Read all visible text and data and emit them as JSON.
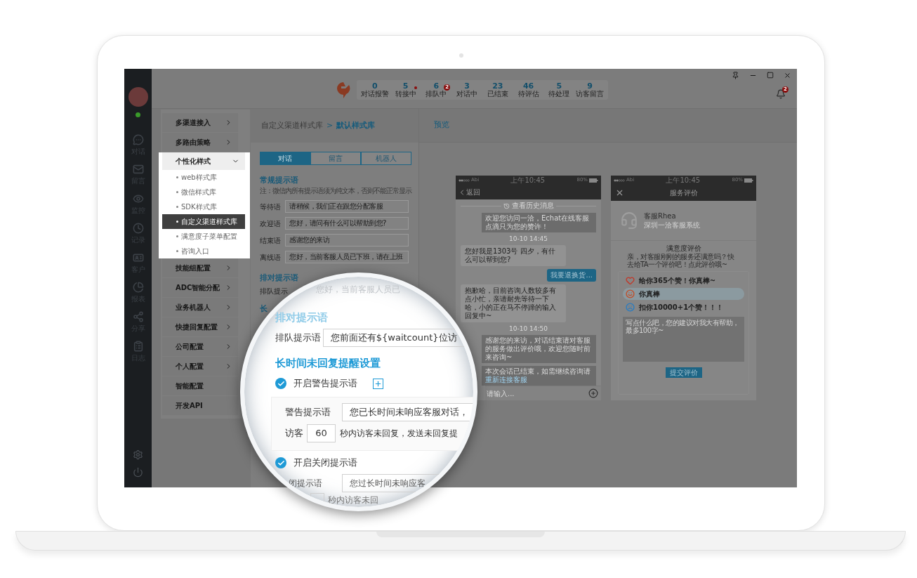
{
  "user": {
    "online": true
  },
  "rail": {
    "items": [
      {
        "kind": "chat",
        "label": "对话"
      },
      {
        "kind": "mail",
        "label": "留言"
      },
      {
        "kind": "eye",
        "label": "监控"
      },
      {
        "kind": "clock",
        "label": "记录"
      },
      {
        "kind": "card",
        "label": "客户"
      },
      {
        "kind": "pie",
        "label": "报表"
      },
      {
        "kind": "share",
        "label": "分享"
      },
      {
        "kind": "log",
        "label": "日志"
      }
    ]
  },
  "top_bar": {
    "stats": [
      {
        "value": "0",
        "label": "对话报警",
        "kind": "plain"
      },
      {
        "value": "5",
        "label": "转接中",
        "kind": "dot"
      },
      {
        "value": "6",
        "label": "排队中",
        "kind": "count",
        "badge": "2"
      },
      {
        "value": "3",
        "label": "对话中",
        "kind": "plain"
      },
      {
        "value": "23",
        "label": "已结束",
        "kind": "plain"
      },
      {
        "value": "46",
        "label": "待评估",
        "kind": "plain"
      },
      {
        "value": "5",
        "label": "待处理",
        "kind": "plain"
      },
      {
        "value": "9",
        "label": "访客留言",
        "kind": "plain"
      }
    ],
    "notifications": {
      "badge": "2"
    }
  },
  "settings_menu": {
    "items": [
      {
        "label": "多渠道接入",
        "expandable": true,
        "expanded": false
      },
      {
        "label": "多路由策略",
        "expandable": true,
        "expanded": false
      },
      {
        "label": "个性化样式",
        "expandable": true,
        "expanded": true,
        "children": [
          {
            "label": "web样式库",
            "selected": false
          },
          {
            "label": "微信样式库",
            "selected": false
          },
          {
            "label": "SDK样式库",
            "selected": false
          },
          {
            "label": "自定义渠道样式库",
            "selected": true
          },
          {
            "label": "满意度子菜单配置",
            "selected": false
          },
          {
            "label": "咨询入口",
            "selected": false
          }
        ]
      },
      {
        "label": "技能组配置",
        "expandable": true,
        "expanded": false
      },
      {
        "label": "ADC智能分配",
        "expandable": true,
        "expanded": false
      },
      {
        "label": "业务机器人",
        "expandable": true,
        "expanded": false
      },
      {
        "label": "快捷回复配置",
        "expandable": true,
        "expanded": false
      },
      {
        "label": "公司配置",
        "expandable": true,
        "expanded": false
      },
      {
        "label": "个人配置",
        "expandable": true,
        "expanded": false
      },
      {
        "label": "智能配置",
        "expandable": false,
        "expanded": false
      },
      {
        "label": "开发API",
        "expandable": false,
        "expanded": false
      }
    ]
  },
  "breadcrumb": {
    "parent": "自定义渠道样式库",
    "separator": ">",
    "current": "默认样式库"
  },
  "tabs": [
    {
      "label": "对话",
      "selected": true
    },
    {
      "label": "留言",
      "selected": false
    },
    {
      "label": "机器人",
      "selected": false
    }
  ],
  "general_prompts": {
    "heading": "常规提示语",
    "note": "注：微信内所有提示语须为纯文本，否则不能正常显示",
    "rows": [
      {
        "label": "等待语",
        "value": "请稍候，我们正在跟您分配客服"
      },
      {
        "label": "欢迎语",
        "value": "您好，请问有什么可以帮助到您?"
      },
      {
        "label": "结束语",
        "value": "感谢您的来访"
      },
      {
        "label": "离线语",
        "value": "您好，当前客服人员已下班，请在上班"
      }
    ]
  },
  "queue_prompt": {
    "heading": "排对提示语",
    "label": "排队提示"
  },
  "timeout_heading": "长",
  "preview": {
    "title": "预览",
    "chat_phone": {
      "status": {
        "carrier": "Abi",
        "time": "上午10:45",
        "battery": "80%"
      },
      "back": "返回",
      "messages": [
        {
          "kind": "history",
          "text": "查看历史消息"
        },
        {
          "kind": "system",
          "text": "欢迎您访问一洽，Echat在线客服点滴只为您的赞许！"
        },
        {
          "kind": "time",
          "text": "10-10 14:45"
        },
        {
          "kind": "agent",
          "text": "您好我是1303号 四夕，有什么可以帮到您?"
        },
        {
          "kind": "visitor",
          "text": "我要退换货..."
        },
        {
          "kind": "agent",
          "text": "抱歉哈，目前咨询人数较多有点小忙，亲请耐先等待一下哈，小的正在马不停蹄的输入回复中~"
        },
        {
          "kind": "time",
          "text": "10-10 14:50"
        },
        {
          "kind": "system",
          "text": "感谢您的来访，对话结束请对客服的服务做出评价哦，欢迎您随时前来咨询~"
        },
        {
          "kind": "ended",
          "text": "本次会话已结束，如需继续咨询请",
          "link": "重新连接客服"
        }
      ],
      "input_placeholder": "请输入..."
    },
    "rating_phone": {
      "status": {
        "carrier": "Abi",
        "time": "上午10:45",
        "battery": "80%"
      },
      "title": "服务评价",
      "agent": {
        "name": "客服Rhea",
        "company": "深圳一洽客服系统"
      },
      "heading": "满意度评价",
      "prompt": "亲，对客服刚刚的服务还满意吗？快去给TA一个评价吧！点此评价哦~",
      "options": [
        {
          "kind": "love",
          "label": "给你365个赞！你真棒~",
          "color": "#c0392b",
          "selected": false
        },
        {
          "kind": "happy",
          "label": "你真棒",
          "color": "#c0502b",
          "selected": true
        },
        {
          "kind": "sad",
          "label": "扣你10000+1个赞！！！",
          "color": "#2b7cc0",
          "selected": false
        }
      ],
      "comment_placeholder": "写点什么吧，您的建议对我大有帮助，最多100字~",
      "submit": "提交评价"
    }
  },
  "magnifier": {
    "faded_value": "您好，当前客服人员已",
    "queue_heading": "排对提示语",
    "queue_label": "排队提示语",
    "queue_value": "您前面还有${waitcount}位访",
    "timeout_heading": "长时间未回复提醒设置",
    "warning": {
      "label": "开启警告提示语",
      "checked": true,
      "field_label": "警告提示语",
      "field_value": "您已长时间未响应客服对话，",
      "visitor_label": "访客",
      "seconds": "60",
      "seconds_text": "秒内访客未回复，发送未回复提"
    },
    "closing": {
      "label": "开启关闭提示语",
      "checked": true,
      "field_label": "闭提示语",
      "field_value": "您过长时间未响应客",
      "seconds_text": "秒内访客未回"
    }
  }
}
